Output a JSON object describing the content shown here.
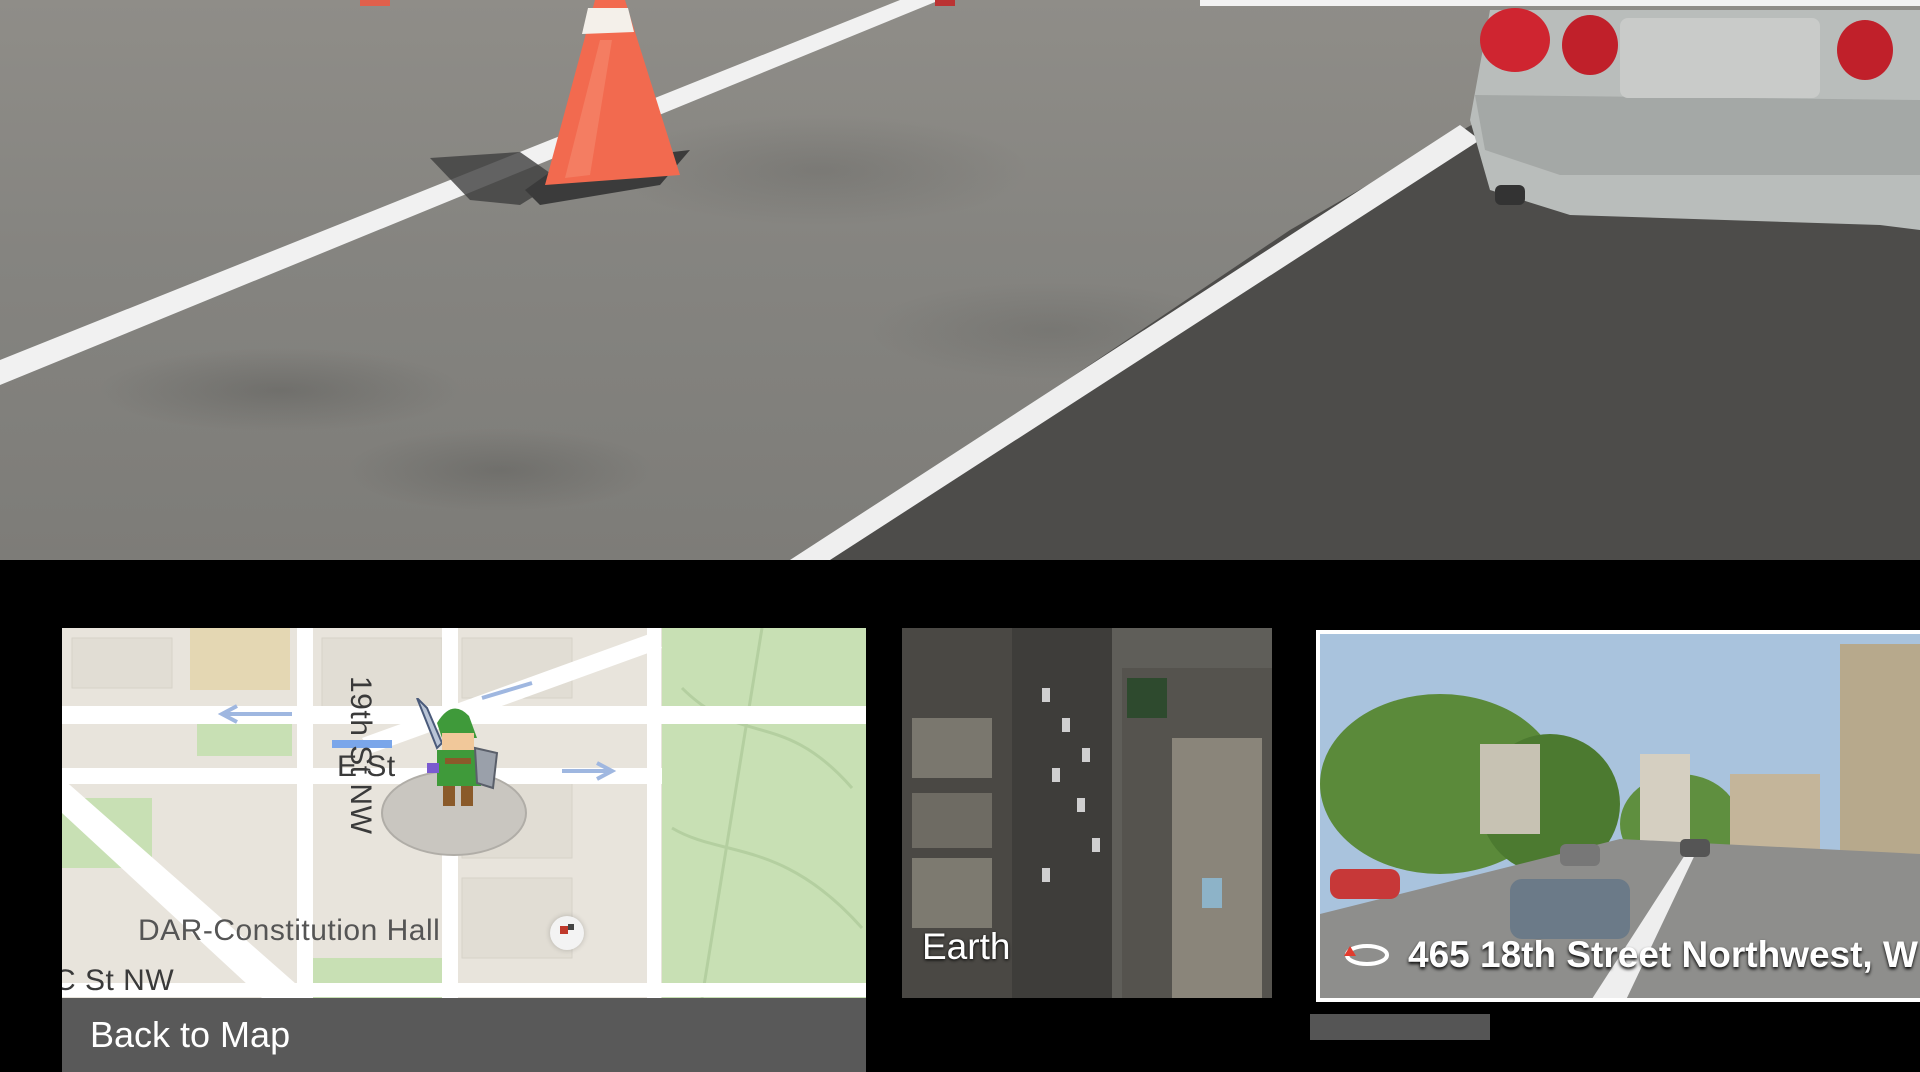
{
  "map": {
    "street_vertical": "19th St NW",
    "street_horizontal": "E St",
    "place": "DAR-Constitution Hall",
    "street_bottom": "C St NW",
    "back_label": "Back to Map"
  },
  "earth": {
    "label": "Earth"
  },
  "street_view": {
    "label": "465 18th Street Northwest, W"
  },
  "icons": [
    "pegman-link-icon",
    "place-pin-icon",
    "rotate-360-icon"
  ],
  "colors": {
    "map_bg": "#e8e4dc",
    "park_green": "#c8e0b4",
    "back_bar": "#595959",
    "cone_orange": "#f26a4f"
  }
}
